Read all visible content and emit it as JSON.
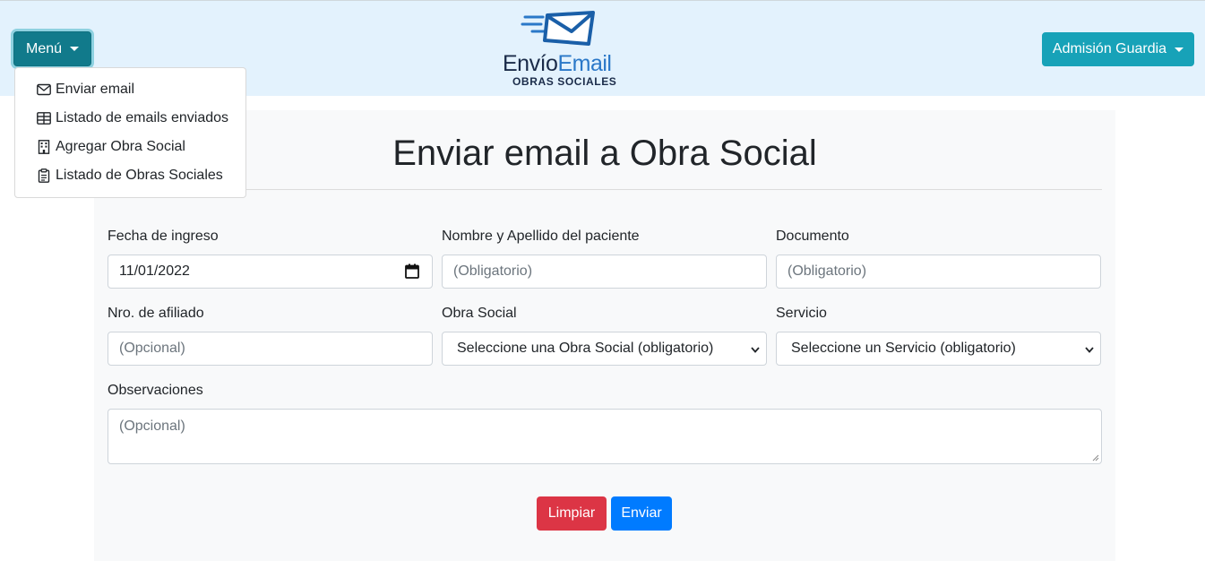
{
  "header": {
    "menu_label": "Menú",
    "user_label": "Admisión Guardia",
    "logo": {
      "word1": "Envío",
      "word2": "Email",
      "subtitle": "OBRAS SOCIALES"
    }
  },
  "menu": {
    "items": [
      {
        "label": "Enviar email",
        "icon": "envelope-icon"
      },
      {
        "label": "Listado de emails enviados",
        "icon": "table-icon"
      },
      {
        "label": "Agregar Obra Social",
        "icon": "building-icon"
      },
      {
        "label": "Listado de Obras Sociales",
        "icon": "clipboard-icon"
      }
    ]
  },
  "form": {
    "title": "Enviar email a Obra Social",
    "fecha": {
      "label": "Fecha de ingreso",
      "value": "11/01/2022"
    },
    "nombre": {
      "label": "Nombre y Apellido del paciente",
      "placeholder": "(Obligatorio)"
    },
    "documento": {
      "label": "Documento",
      "placeholder": "(Obligatorio)"
    },
    "afiliado": {
      "label": "Nro. de afiliado",
      "placeholder": "(Opcional)"
    },
    "obra_social": {
      "label": "Obra Social",
      "selected": "Seleccione una Obra Social (obligatorio)"
    },
    "servicio": {
      "label": "Servicio",
      "selected": "Seleccione un Servicio (obligatorio)"
    },
    "observaciones": {
      "label": "Observaciones",
      "placeholder": "(Opcional)"
    },
    "clear_label": "Limpiar",
    "send_label": "Enviar"
  },
  "colors": {
    "navbar_bg": "#e3f2fd",
    "menu_btn": "#117a8b",
    "user_btn": "#17a2b8",
    "danger": "#dc3545",
    "primary": "#007bff",
    "card_bg": "#f8f9fa"
  }
}
